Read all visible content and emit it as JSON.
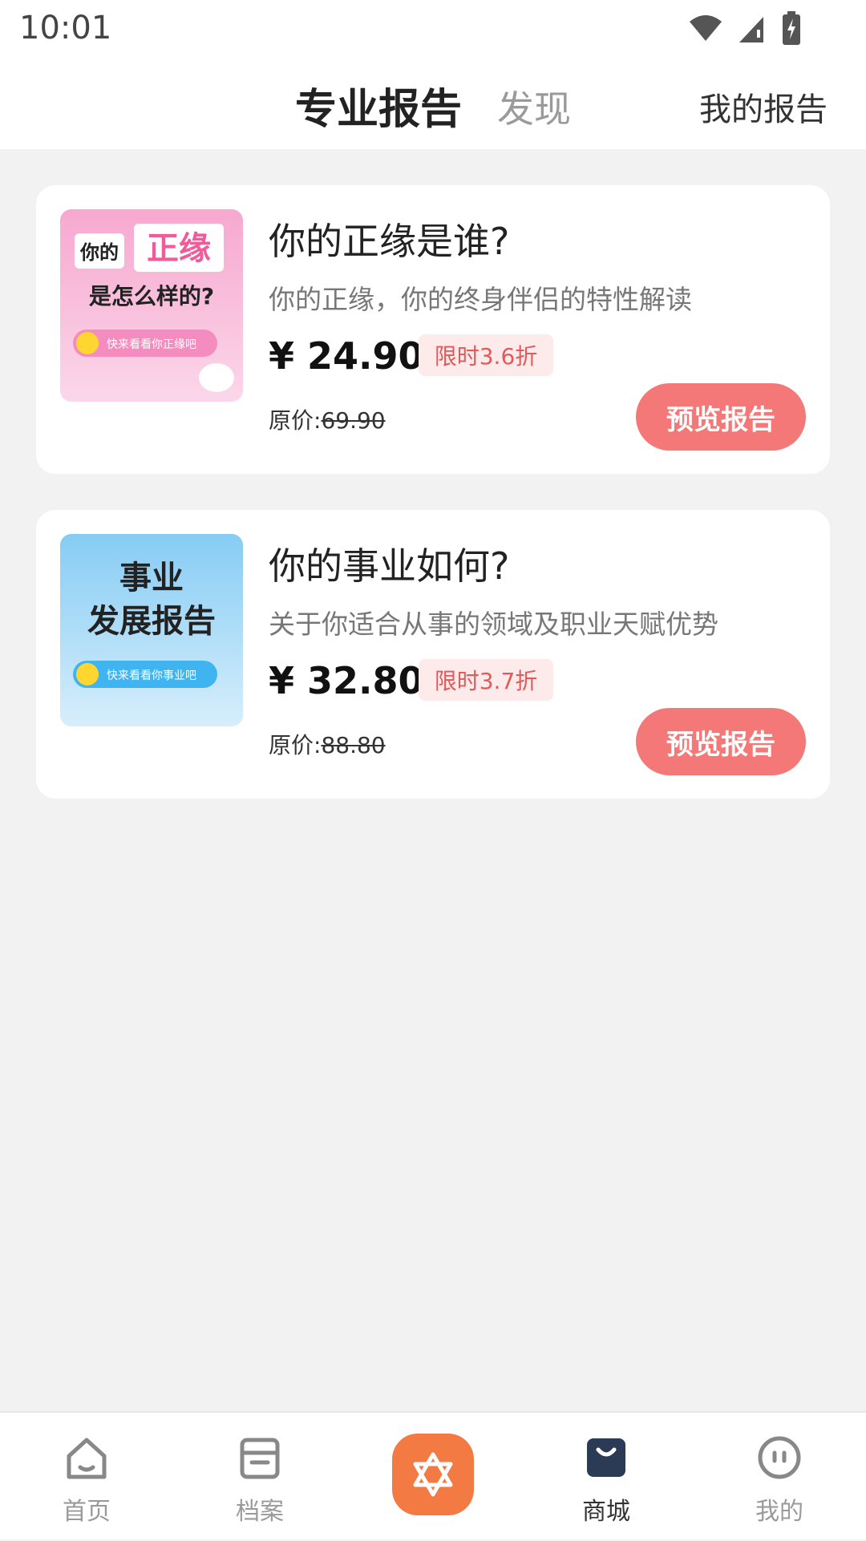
{
  "status_bar": {
    "time": "10:01",
    "icons": [
      "wifi-icon",
      "signal-icon",
      "battery-icon"
    ]
  },
  "header": {
    "tabs": [
      {
        "label": "专业报告",
        "active": true
      },
      {
        "label": "发现",
        "active": false
      }
    ],
    "right_link": "我的报告"
  },
  "products": [
    {
      "thumb_lines": [
        "你的",
        "正缘",
        "是怎么样的?",
        "快来看看你正缘吧"
      ],
      "title": "你的正缘是谁?",
      "subtitle": "你的正缘，你的终身伴侣的特性解读",
      "price": "¥ 24.90",
      "discount": "限时3.6折",
      "original_label": "原价:",
      "original_price": "69.90",
      "button": "预览报告"
    },
    {
      "thumb_lines": [
        "事业",
        "发展报告",
        "快来看看你事业吧"
      ],
      "title": "你的事业如何?",
      "subtitle": "关于你适合从事的领域及职业天赋优势",
      "price": "¥ 32.80",
      "discount": "限时3.7折",
      "original_label": "原价:",
      "original_price": "88.80",
      "button": "预览报告"
    }
  ],
  "bottom_nav": [
    {
      "label": "首页",
      "icon": "home-icon",
      "active": false
    },
    {
      "label": "档案",
      "icon": "archive-icon",
      "active": false
    },
    {
      "label": "",
      "icon": "star-of-david-icon",
      "active": false
    },
    {
      "label": "商城",
      "icon": "shopping-bag-icon",
      "active": true
    },
    {
      "label": "我的",
      "icon": "profile-icon",
      "active": false
    }
  ],
  "colors": {
    "accent": "#f47878",
    "center_button": "#f47a44",
    "discount_text": "#e15a5a",
    "discount_bg": "#fdeaea",
    "pink_thumb": "#f9b6d6",
    "blue_thumb": "#8fd1f5"
  }
}
